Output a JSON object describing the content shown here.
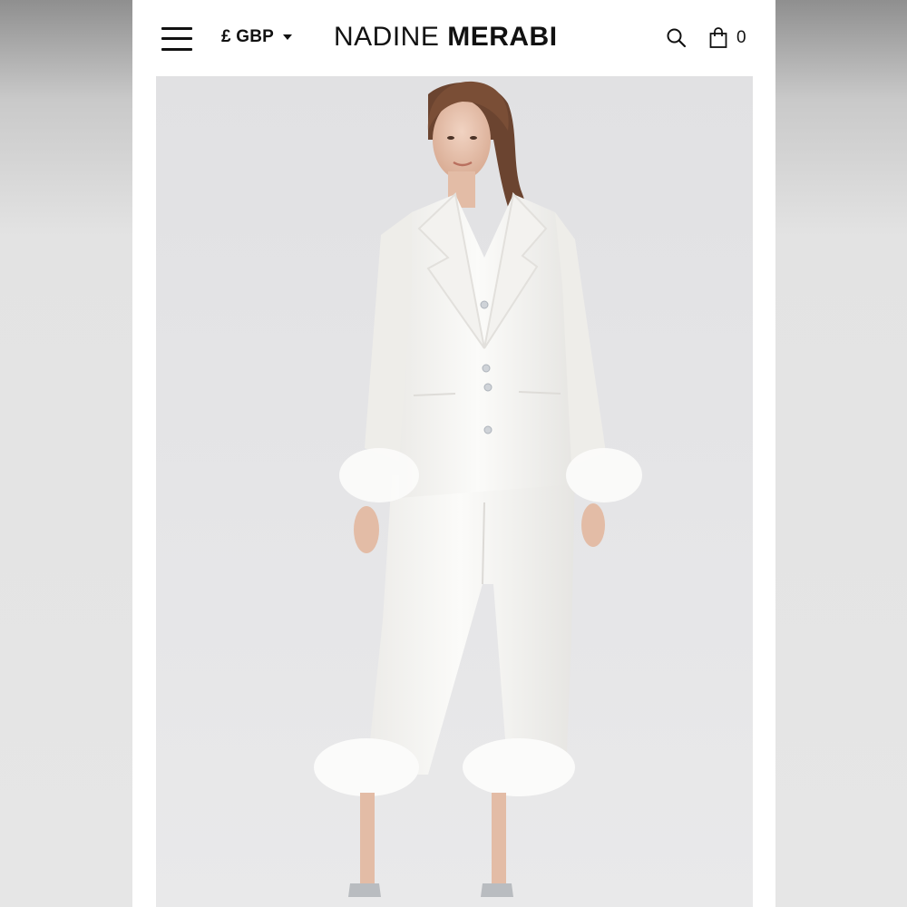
{
  "header": {
    "currency_label": "£ GBP",
    "brand_light": "NADINE",
    "brand_bold": "MERABI",
    "cart_count": "0"
  },
  "icons": {
    "menu": "hamburger-menu-icon",
    "currency_caret": "chevron-down-icon",
    "search": "search-icon",
    "cart": "shopping-bag-icon"
  },
  "colors": {
    "header_bg": "#ffffff",
    "text": "#111111",
    "image_bg": "#e4e4e6",
    "garment": "#f7f7f5"
  }
}
